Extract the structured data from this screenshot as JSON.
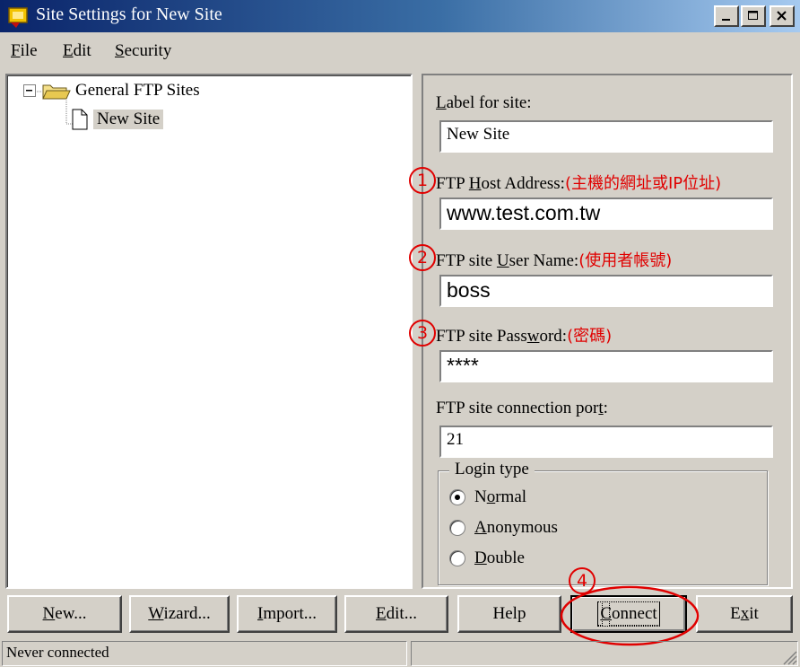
{
  "window": {
    "title": "Site Settings for New Site"
  },
  "menu": {
    "items": [
      {
        "label": "File",
        "accel": "F",
        "rest": "ile"
      },
      {
        "label": "Edit",
        "accel": "E",
        "rest": "dit"
      },
      {
        "label": "Security",
        "accel": "S",
        "rest": "ecurity"
      }
    ]
  },
  "tree": {
    "expander": "⊟",
    "root_label": "General FTP Sites",
    "child_label": "New Site"
  },
  "form": {
    "site_label": {
      "pre": "",
      "accel": "L",
      "post": "abel for site:"
    },
    "site_value": "New Site",
    "host": {
      "pre": "FTP ",
      "accel": "H",
      "post": "ost Address:",
      "note": "(主機的網址或IP位址)",
      "marker": "1"
    },
    "host_value": "www.test.com.tw",
    "user": {
      "pre": "FTP site ",
      "accel": "U",
      "post": "ser Name:",
      "note": "(使用者帳號)",
      "marker": "2"
    },
    "user_value": "boss",
    "password": {
      "pre": "FTP site Pass",
      "accel": "w",
      "post": "ord:",
      "note": "(密碼)",
      "marker": "3"
    },
    "password_value": "****",
    "port": {
      "pre": "FTP site connection por",
      "accel": "t",
      "post": ":"
    },
    "port_value": "21",
    "login_type": {
      "legend": "Login type",
      "options": [
        {
          "pre": "N",
          "accel": "o",
          "post": "rmal",
          "checked": true
        },
        {
          "pre": "",
          "accel": "A",
          "post": "nonymous",
          "checked": false
        },
        {
          "pre": "",
          "accel": "D",
          "post": "ouble",
          "checked": false
        }
      ]
    }
  },
  "buttons": [
    {
      "id": "new",
      "pre": "",
      "accel": "N",
      "post": "ew..."
    },
    {
      "id": "wizard",
      "pre": "",
      "accel": "W",
      "post": "izard..."
    },
    {
      "id": "import",
      "pre": "",
      "accel": "I",
      "post": "mport..."
    },
    {
      "id": "edit",
      "pre": "",
      "accel": "E",
      "post": "dit..."
    },
    {
      "id": "help",
      "pre": "Help",
      "accel": "",
      "post": ""
    },
    {
      "id": "connect",
      "pre": "",
      "accel": "C",
      "post": "onnect"
    },
    {
      "id": "exit",
      "pre": "E",
      "accel": "x",
      "post": "it"
    }
  ],
  "connect_marker": "4",
  "status": {
    "text": "Never connected"
  },
  "colors": {
    "annotation": "#e00000",
    "title_start": "#0a246a",
    "title_end": "#a6caf0"
  }
}
